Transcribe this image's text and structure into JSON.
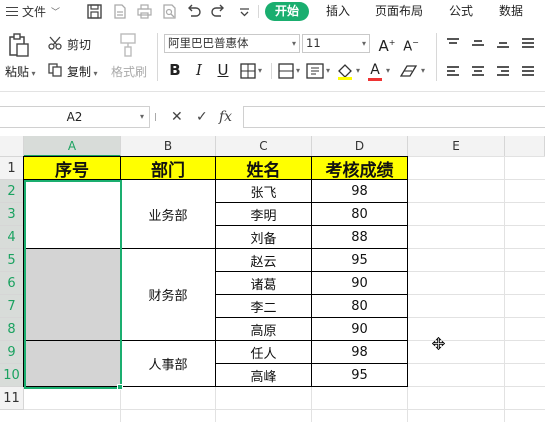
{
  "menubar": {
    "file_label": "文件",
    "tabs": [
      {
        "label": "开始",
        "active": true
      },
      {
        "label": "插入",
        "active": false
      },
      {
        "label": "页面布局",
        "active": false
      },
      {
        "label": "公式",
        "active": false
      },
      {
        "label": "数据",
        "active": false
      }
    ]
  },
  "ribbon": {
    "paste_label": "粘贴",
    "cut_label": "剪切",
    "copy_label": "复制",
    "format_painter_label": "格式刷",
    "font_name": "阿里巴巴普惠体",
    "font_size": "11",
    "bold": "B",
    "italic": "I",
    "underline": "U",
    "increase_font": "A",
    "decrease_font": "A",
    "font_color": "A"
  },
  "formula_bar": {
    "name_box": "A2",
    "cancel": "✕",
    "confirm": "✓",
    "fx": "fx",
    "content": ""
  },
  "sheet": {
    "columns": [
      "A",
      "B",
      "C",
      "D",
      "E"
    ],
    "selected_column": "A",
    "rows": [
      "1",
      "2",
      "3",
      "4",
      "5",
      "6",
      "7",
      "8",
      "9",
      "10",
      "11"
    ],
    "selected_rows": [
      "2",
      "3",
      "4",
      "5",
      "6",
      "7",
      "8",
      "9",
      "10"
    ],
    "header": [
      "序号",
      "部门",
      "姓名",
      "考核成绩"
    ],
    "departments": [
      {
        "name": "业务部",
        "rows": 3
      },
      {
        "name": "财务部",
        "rows": 4
      },
      {
        "name": "人事部",
        "rows": 2
      }
    ],
    "records": [
      {
        "name": "张飞",
        "score": "98"
      },
      {
        "name": "李明",
        "score": "80"
      },
      {
        "name": "刘备",
        "score": "88"
      },
      {
        "name": "赵云",
        "score": "95"
      },
      {
        "name": "诸葛",
        "score": "90"
      },
      {
        "name": "李二",
        "score": "80"
      },
      {
        "name": "高原",
        "score": "90"
      },
      {
        "name": "任人",
        "score": "98"
      },
      {
        "name": "高峰",
        "score": "95"
      }
    ]
  },
  "colors": {
    "accent": "#1aae6f",
    "header_fill": "#ffff00",
    "merged_fill": "#d4d4d4"
  }
}
